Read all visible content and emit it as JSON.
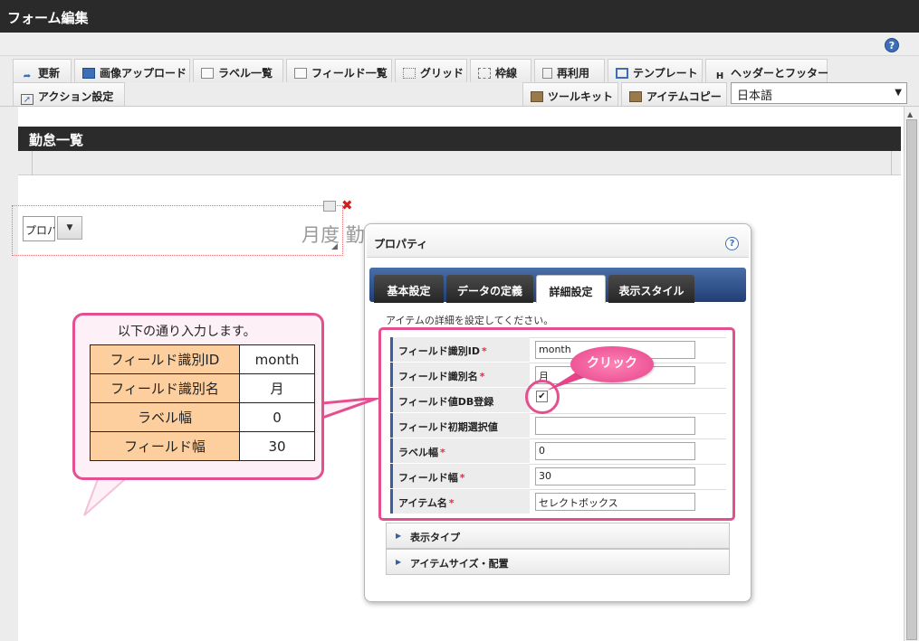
{
  "window": {
    "title": "フォーム編集",
    "help_glyph": "?"
  },
  "toolbar": {
    "row1": [
      "更新",
      "画像アップロード",
      "ラベル一覧",
      "フィールド一覧",
      "グリッド",
      "枠線",
      "再利用",
      "テンプレート",
      "ヘッダーとフッター"
    ],
    "row2_left": "アクション設定",
    "row2_right": [
      "ツールキット",
      "アイテムコピー"
    ],
    "language": "日本語",
    "language_arrow": "▼"
  },
  "form": {
    "title": "勤怠一覧"
  },
  "item": {
    "select_text": "プロパ",
    "arrow": "▼",
    "label": "月度 勤",
    "delete_glyph": "✖",
    "resize_glyph": "◢"
  },
  "dialog": {
    "title": "プロパティ",
    "help_glyph": "?",
    "tabs": [
      "基本設定",
      "データの定義",
      "詳細設定",
      "表示スタイル"
    ],
    "active_tab": "詳細設定",
    "description": "アイテムの詳細を設定してください。",
    "required_mark": "*",
    "fields": [
      {
        "label": "フィールド識別ID",
        "required": true,
        "value": "month"
      },
      {
        "label": "フィールド識別名",
        "required": true,
        "value": "月"
      },
      {
        "label": "フィールド値DB登録",
        "required": false,
        "checked": true,
        "check_glyph": "✔"
      },
      {
        "label": "フィールド初期選択値",
        "required": false,
        "value": ""
      },
      {
        "label": "ラベル幅",
        "required": true,
        "value": "0"
      },
      {
        "label": "フィールド幅",
        "required": true,
        "value": "30"
      },
      {
        "label": "アイテム名",
        "required": true,
        "value": "セレクトボックス"
      }
    ],
    "sections": [
      "表示タイプ",
      "アイテムサイズ・配置"
    ],
    "section_arrow": "▶"
  },
  "annotation": {
    "click": "クリック",
    "accent_color": "#e4508f"
  },
  "callout": {
    "title": "以下の通り入力します。",
    "rows": [
      {
        "key": "フィールド識別ID",
        "value": "month"
      },
      {
        "key": "フィールド識別名",
        "value": "月"
      },
      {
        "key": "ラベル幅",
        "value": "0"
      },
      {
        "key": "フィールド幅",
        "value": "30"
      }
    ]
  }
}
